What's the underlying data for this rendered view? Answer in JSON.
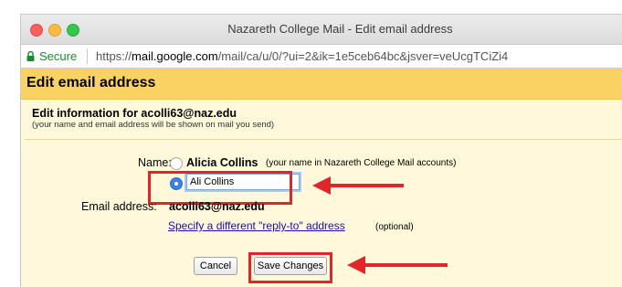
{
  "window": {
    "title": "Nazareth College Mail - Edit email address",
    "secure_label": "Secure",
    "url_prefix": "https://",
    "url_domain": "mail.google.com",
    "url_path": "/mail/ca/u/0/?ui=2&ik=1e5ceb64bc&jsver=veUcgTCiZi4"
  },
  "header": {
    "title": "Edit email address"
  },
  "form": {
    "edit_info": "Edit information for acolli63@naz.edu",
    "edit_sub": "(your name and email address will be shown on mail you send)",
    "name_label": "Name:",
    "name_option": "Alicia Collins",
    "name_hint": "(your name in Nazareth College Mail accounts)",
    "name_input_value": "Ali Collins",
    "email_label": "Email address:",
    "email_value": "acolli63@naz.edu",
    "reply_link": "Specify a different \"reply-to\" address",
    "optional": "(optional)",
    "cancel_label": "Cancel",
    "save_label": "Save Changes"
  },
  "annotation_color": "#e0262b",
  "name_option_selected": 2
}
